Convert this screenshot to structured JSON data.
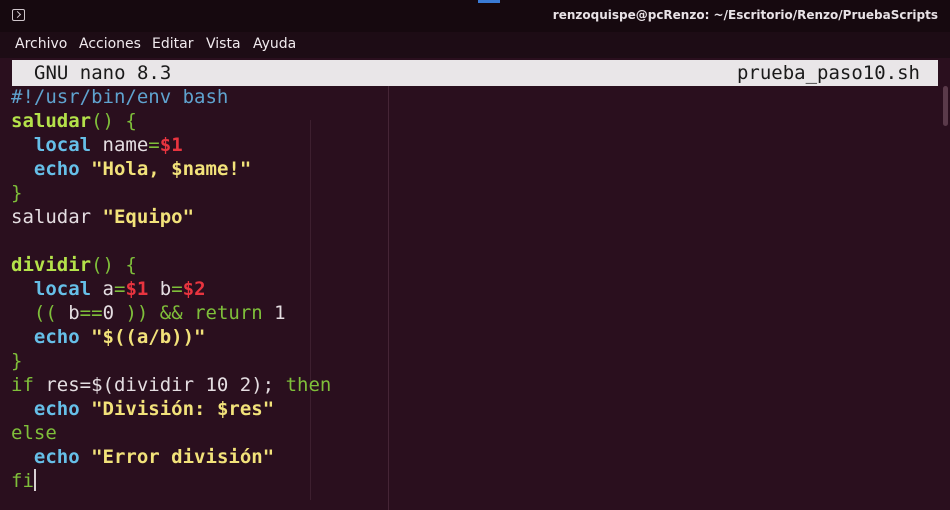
{
  "window": {
    "title": "renzoquispe@pcRenzo: ~/Escritorio/Renzo/PruebaScripts"
  },
  "menu": [
    "Archivo",
    "Acciones",
    "Editar",
    "Vista",
    "Ayuda"
  ],
  "nano": {
    "version": "GNU nano 8.3",
    "filename": "prueba_paso10.sh"
  },
  "colors": {
    "keyword": "#7fbf3a",
    "function": "#b4e24a",
    "string": "#f2e27a",
    "variable": "#e8343f",
    "builtin": "#66bfe8",
    "comment": "#5fa3cf",
    "text": "#e4dde1"
  },
  "code": [
    [
      [
        "#!/usr/bin/env bash",
        "comment"
      ]
    ],
    [
      [
        "saludar",
        "function"
      ],
      [
        "() {",
        "keyword"
      ]
    ],
    [
      [
        "  ",
        "text"
      ],
      [
        "local",
        "builtin"
      ],
      [
        " name",
        "text"
      ],
      [
        "=",
        "keyword"
      ],
      [
        "$1",
        "variable"
      ]
    ],
    [
      [
        "  ",
        "text"
      ],
      [
        "echo",
        "builtin"
      ],
      [
        " ",
        "text"
      ],
      [
        "\"Hola, $name!\"",
        "string"
      ]
    ],
    [
      [
        "}",
        "keyword"
      ]
    ],
    [
      [
        "saludar ",
        "text"
      ],
      [
        "\"Equipo\"",
        "string"
      ]
    ],
    [
      [
        "",
        "text"
      ]
    ],
    [
      [
        "dividir",
        "function"
      ],
      [
        "() {",
        "keyword"
      ]
    ],
    [
      [
        "  ",
        "text"
      ],
      [
        "local",
        "builtin"
      ],
      [
        " a",
        "text"
      ],
      [
        "=",
        "keyword"
      ],
      [
        "$1",
        "variable"
      ],
      [
        " b",
        "text"
      ],
      [
        "=",
        "keyword"
      ],
      [
        "$2",
        "variable"
      ]
    ],
    [
      [
        "  ",
        "text"
      ],
      [
        "((",
        "keyword"
      ],
      [
        " b",
        "text"
      ],
      [
        "==",
        "keyword"
      ],
      [
        "0",
        "text"
      ],
      [
        " )) && ",
        "keyword"
      ],
      [
        "return",
        "keyword"
      ],
      [
        " 1",
        "text"
      ]
    ],
    [
      [
        "  ",
        "text"
      ],
      [
        "echo",
        "builtin"
      ],
      [
        " ",
        "text"
      ],
      [
        "\"$((a/b))\"",
        "string"
      ]
    ],
    [
      [
        "}",
        "keyword"
      ]
    ],
    [
      [
        "if",
        "keyword"
      ],
      [
        " res=$(dividir 10 2); ",
        "text"
      ],
      [
        "then",
        "keyword"
      ]
    ],
    [
      [
        "  ",
        "text"
      ],
      [
        "echo",
        "builtin"
      ],
      [
        " ",
        "text"
      ],
      [
        "\"División: $res\"",
        "string"
      ]
    ],
    [
      [
        "else",
        "keyword"
      ]
    ],
    [
      [
        "  ",
        "text"
      ],
      [
        "echo",
        "builtin"
      ],
      [
        " ",
        "text"
      ],
      [
        "\"Error división\"",
        "string"
      ]
    ],
    [
      [
        "fi",
        "keyword"
      ]
    ]
  ]
}
